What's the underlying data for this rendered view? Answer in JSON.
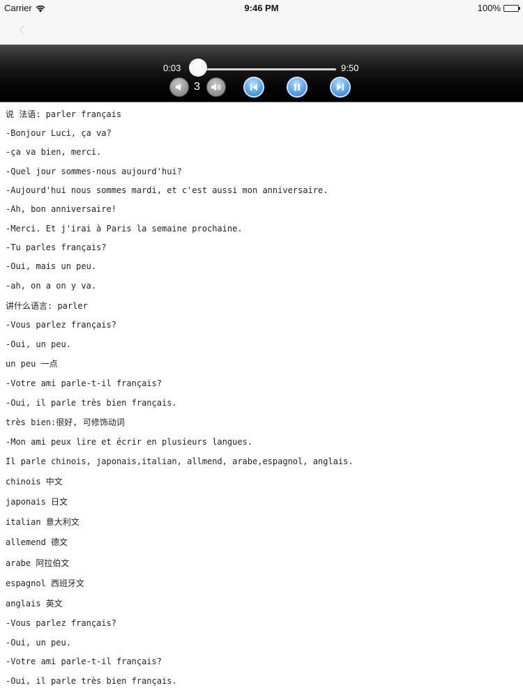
{
  "status_bar": {
    "carrier": "Carrier",
    "time": "9:46 PM",
    "battery": "100%",
    "icons": [
      "wifi-icon",
      "battery-icon"
    ]
  },
  "nav_bar": {
    "back_icon": "chevron-left-icon"
  },
  "player": {
    "current_time": "0:03",
    "total_time": "9:50",
    "progress": 0.005,
    "volume_level": "3",
    "icons": [
      "volume-down-icon",
      "volume-up-icon",
      "skip-previous-icon",
      "pause-icon",
      "skip-next-icon"
    ],
    "accent_color": "#5aa4ef"
  },
  "transcript": {
    "lines": [
      "说 法语: parler français",
      "-Bonjour Luci, ça va?",
      "-ça va bien, merci.",
      "-Quel jour sommes-nous aujourd'hui?",
      "-Aujourd'hui nous sommes mardi, et c'est aussi mon anniversaire.",
      "-Ah, bon anniversaire!",
      "-Merci. Et j'irai à Paris la semaine prochaine.",
      "-Tu parles français?",
      "-Oui, mais un peu.",
      "-ah, on a on y va.",
      "讲什么语言: parler",
      "-Vous parlez français?",
      "-Oui, un peu.",
      "un peu 一点",
      "-Votre ami parle-t-il français?",
      "-Oui, il parle très bien français.",
      "très bien:很好, 可修饰动词",
      "-Mon ami peux lire et écrir en plusieurs langues.",
      "Il parle chinois, japonais,italian, allmend, arabe,espagnol, anglais.",
      "chinois 中文",
      "japonais 日文",
      "italian 意大利文",
      "allemend 德文",
      "arabe 阿拉伯文",
      "espagnol 西班牙文",
      "anglais 英文",
      "-Vous parlez français?",
      "-Oui, un peu.",
      "-Votre ami parle-t-il français?",
      "-Oui, il parle très bien français."
    ]
  }
}
